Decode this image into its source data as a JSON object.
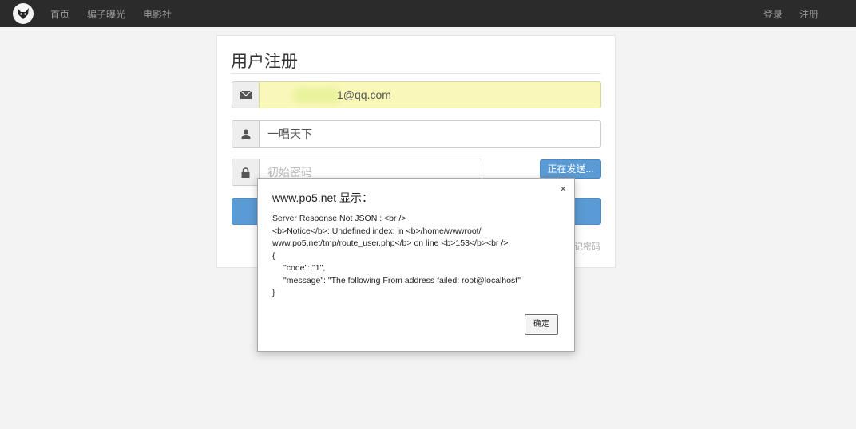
{
  "navbar": {
    "links": [
      "首页",
      "骗子曝光",
      "电影社"
    ],
    "login": "登录",
    "register": "注册"
  },
  "form": {
    "title": "用户注册",
    "email_value": "1@qq.com",
    "username_value": "一唱天下",
    "password_placeholder": "初始密码",
    "send_button": "正在发送...",
    "forgot_link": "记密码"
  },
  "dialog": {
    "title": "www.po5.net 显示：",
    "lines": [
      "Server Response Not JSON : <br />",
      "<b>Notice</b>:  Undefined index:  in <b>/home/wwwroot/",
      "www.po5.net/tmp/route_user.php</b> on line <b>153</b><br />",
      "{",
      "\"code\": \"1\",",
      "\"message\": \"The following From address failed: root@localhost\"",
      "}"
    ],
    "close": "×",
    "ok_button": "确定"
  },
  "colors": {
    "navbar": "#2b2b2b",
    "primary": "#5b9bd5",
    "autofill": "#f9f8b9"
  },
  "icons": [
    "logo-icon",
    "envelope-icon",
    "user-icon",
    "lock-icon",
    "close-icon"
  ]
}
